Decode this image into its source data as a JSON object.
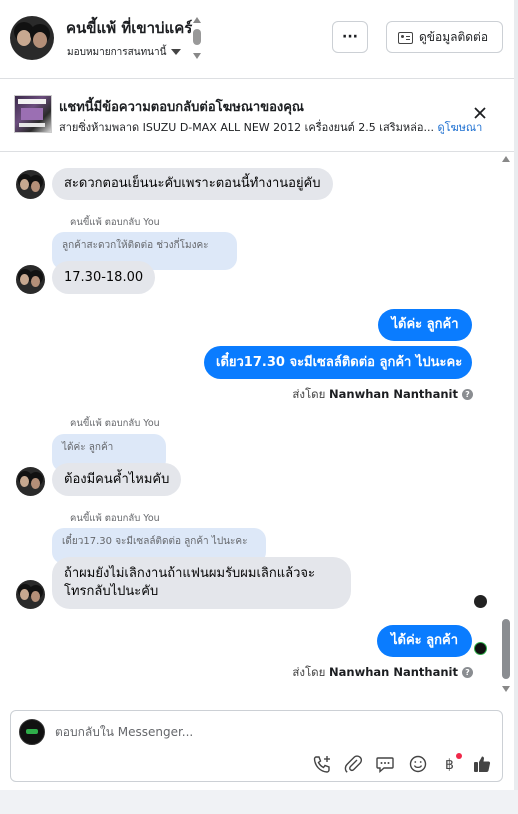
{
  "header": {
    "contact_name": "คนขี้แพ้ ที่เขาบ่แคร์",
    "assign_label": "มอบหมายการสนทนานี้",
    "more_label": "···",
    "contact_info_label": "ดูข้อมูลติดต่อ"
  },
  "ad_banner": {
    "title": "แชทนี้มีข้อความตอบกลับต่อโฆษณาของคุณ",
    "subtitle": "สายซิ่งห้ามพลาด ISUZU D-MAX ALL NEW 2012 เครื่องยนต์ 2.5 เสริมหล่อ... ",
    "view_ad_link": "ดูโฆษณา"
  },
  "messages": [
    {
      "id": "m1",
      "direction": "in",
      "text": "สะดวกตอนเย็นนะคับเพราะตอนนี้ทำงานอยู่คับ"
    },
    {
      "id": "m2",
      "direction": "in",
      "reply_header": "คนขี้แพ้ ตอบกลับ You",
      "quoted": "ลูกค้าสะดวกให้ติดต่อ ช่วงกี่โมงคะ",
      "text": "17.30-18.00"
    },
    {
      "id": "m3",
      "direction": "out",
      "text": "ได้ค่ะ  ลูกค้า"
    },
    {
      "id": "m4",
      "direction": "out",
      "text": "เดี๋ยว17.30 จะมีเซลล์ติดต่อ ลูกค้า ไปนะคะ"
    },
    {
      "id": "s1",
      "type": "sent_by",
      "prefix": "ส่งโดย",
      "name": "Nanwhan Nanthanit"
    },
    {
      "id": "m5",
      "direction": "in",
      "reply_header": "คนขี้แพ้ ตอบกลับ You",
      "quoted": "ได้ค่ะ ลูกค้า",
      "text": "ต้องมีคนค้ำไหมคับ"
    },
    {
      "id": "m6",
      "direction": "in",
      "reply_header": "คนขี้แพ้ ตอบกลับ You",
      "quoted": "เดี๋ยว17.30 จะมีเซลล์ติดต่อ ลูกค้า ไปนะคะ",
      "text_line1": "ถ้าผมยังไม่เลิกงานถ้าแฟนผมรับผมเลิกแล้วจะ",
      "text_line2": "โทรกลับไปนะคับ"
    },
    {
      "id": "m7",
      "direction": "out",
      "text": "ได้ค่ะ  ลูกค้า"
    },
    {
      "id": "s2",
      "type": "sent_by",
      "prefix": "ส่งโดย",
      "name": "Nanwhan Nanthanit"
    }
  ],
  "composer": {
    "placeholder": "ตอบกลับใน Messenger..."
  },
  "icons": {
    "call": "phone-add-icon",
    "attach": "paperclip-icon",
    "saved_replies": "chat-bubble-icon",
    "emoji": "emoji-icon",
    "payment": "baht-icon",
    "like": "thumbs-up-icon"
  },
  "colors": {
    "outgoing_bubble": "#0a7cff",
    "incoming_bubble": "#e4e6eb",
    "quote_bubble": "#dde8f8",
    "link": "#1c6fd1"
  }
}
